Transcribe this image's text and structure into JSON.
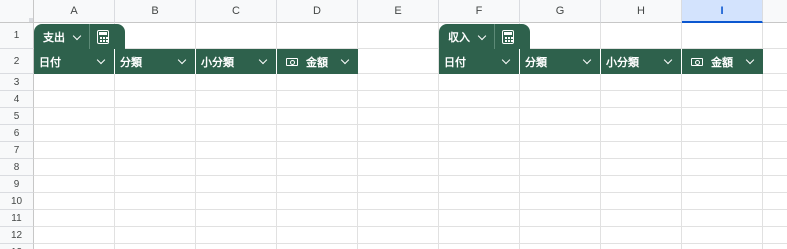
{
  "columns": [
    "A",
    "B",
    "C",
    "D",
    "E",
    "F",
    "G",
    "H",
    "I"
  ],
  "selected_column": "I",
  "rows": [
    "1",
    "2",
    "3",
    "4",
    "5",
    "6",
    "7",
    "8",
    "9",
    "10",
    "11",
    "12",
    "13"
  ],
  "tables": [
    {
      "name": "支出",
      "headers": [
        {
          "label": "日付",
          "icon": null
        },
        {
          "label": "分類",
          "icon": null
        },
        {
          "label": "小分類",
          "icon": null
        },
        {
          "label": "金額",
          "icon": "money-icon"
        }
      ]
    },
    {
      "name": "収入",
      "headers": [
        {
          "label": "日付",
          "icon": null
        },
        {
          "label": "分類",
          "icon": null
        },
        {
          "label": "小分類",
          "icon": null
        },
        {
          "label": "金額",
          "icon": "money-icon"
        }
      ]
    }
  ],
  "colors": {
    "table_header": "#2e614c",
    "selected_column_bg": "#d3e3fd",
    "selected_column_text": "#0b57d0",
    "grid_line": "#e1e1e1"
  }
}
